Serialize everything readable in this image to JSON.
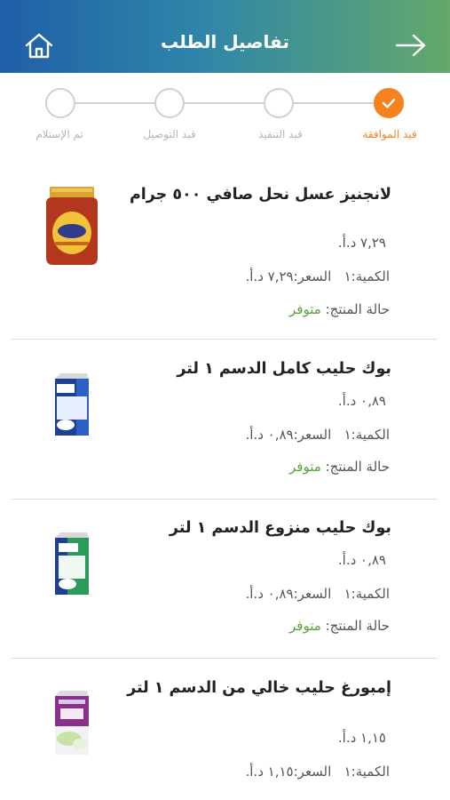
{
  "header": {
    "title": "تفاصيل الطلب"
  },
  "steps": [
    {
      "label": "قيد الموافقة",
      "active": true
    },
    {
      "label": "قيد التنفيذ",
      "active": false
    },
    {
      "label": "قيد التوصيل",
      "active": false
    },
    {
      "label": "تم الإستلام",
      "active": false
    }
  ],
  "labels": {
    "quantity": "الكمية:",
    "price": "السعر:",
    "status": "حالة المنتج:"
  },
  "items": [
    {
      "name": "لانجنيز عسل نحل صافي ٥٠٠ جرام",
      "unit_price": "٧,٢٩ د.أ.",
      "quantity": "١",
      "price": "٧,٢٩ د.أ.",
      "status": "متوفر",
      "thumb": "honey-jar"
    },
    {
      "name": "بوك حليب كامل الدسم ١ لتر",
      "unit_price": "٠,٨٩ د.أ.",
      "quantity": "١",
      "price": "٠,٨٩ د.أ.",
      "status": "متوفر",
      "thumb": "milk-carton-blue"
    },
    {
      "name": "بوك حليب منزوع الدسم ١ لتر",
      "unit_price": "٠,٨٩ د.أ.",
      "quantity": "١",
      "price": "٠,٨٩ د.أ.",
      "status": "متوفر",
      "thumb": "milk-carton-green"
    },
    {
      "name": "إمبورغ حليب خالي من الدسم ١ لتر",
      "unit_price": "١,١٥ د.أ.",
      "quantity": "١",
      "price": "١,١٥ د.أ.",
      "status": "",
      "thumb": "milk-carton-purple"
    }
  ],
  "icons": {
    "home": "home-icon",
    "back": "arrow-right-icon",
    "check": "check-icon"
  },
  "colors": {
    "accent": "#f5821f",
    "available": "#5aa33c",
    "header_start": "#1f5fa8",
    "header_end": "#64a86b"
  }
}
